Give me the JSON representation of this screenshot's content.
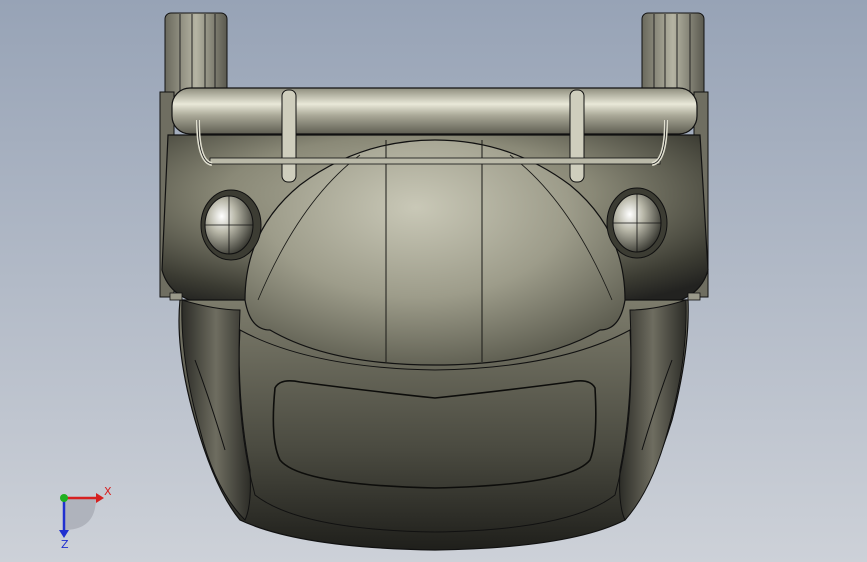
{
  "viewport": {
    "background_top": "#9aa6b8",
    "background_bottom": "#c9ced6",
    "model_colors": {
      "body_light": "#a4a392",
      "body_mid": "#7f7e6d",
      "body_dark": "#2e2e27",
      "edge": "#111111"
    }
  },
  "triad": {
    "x_label": "X",
    "z_label": "Z",
    "x_color": "#d62020",
    "y_color": "#20b020",
    "z_color": "#2030d0"
  }
}
